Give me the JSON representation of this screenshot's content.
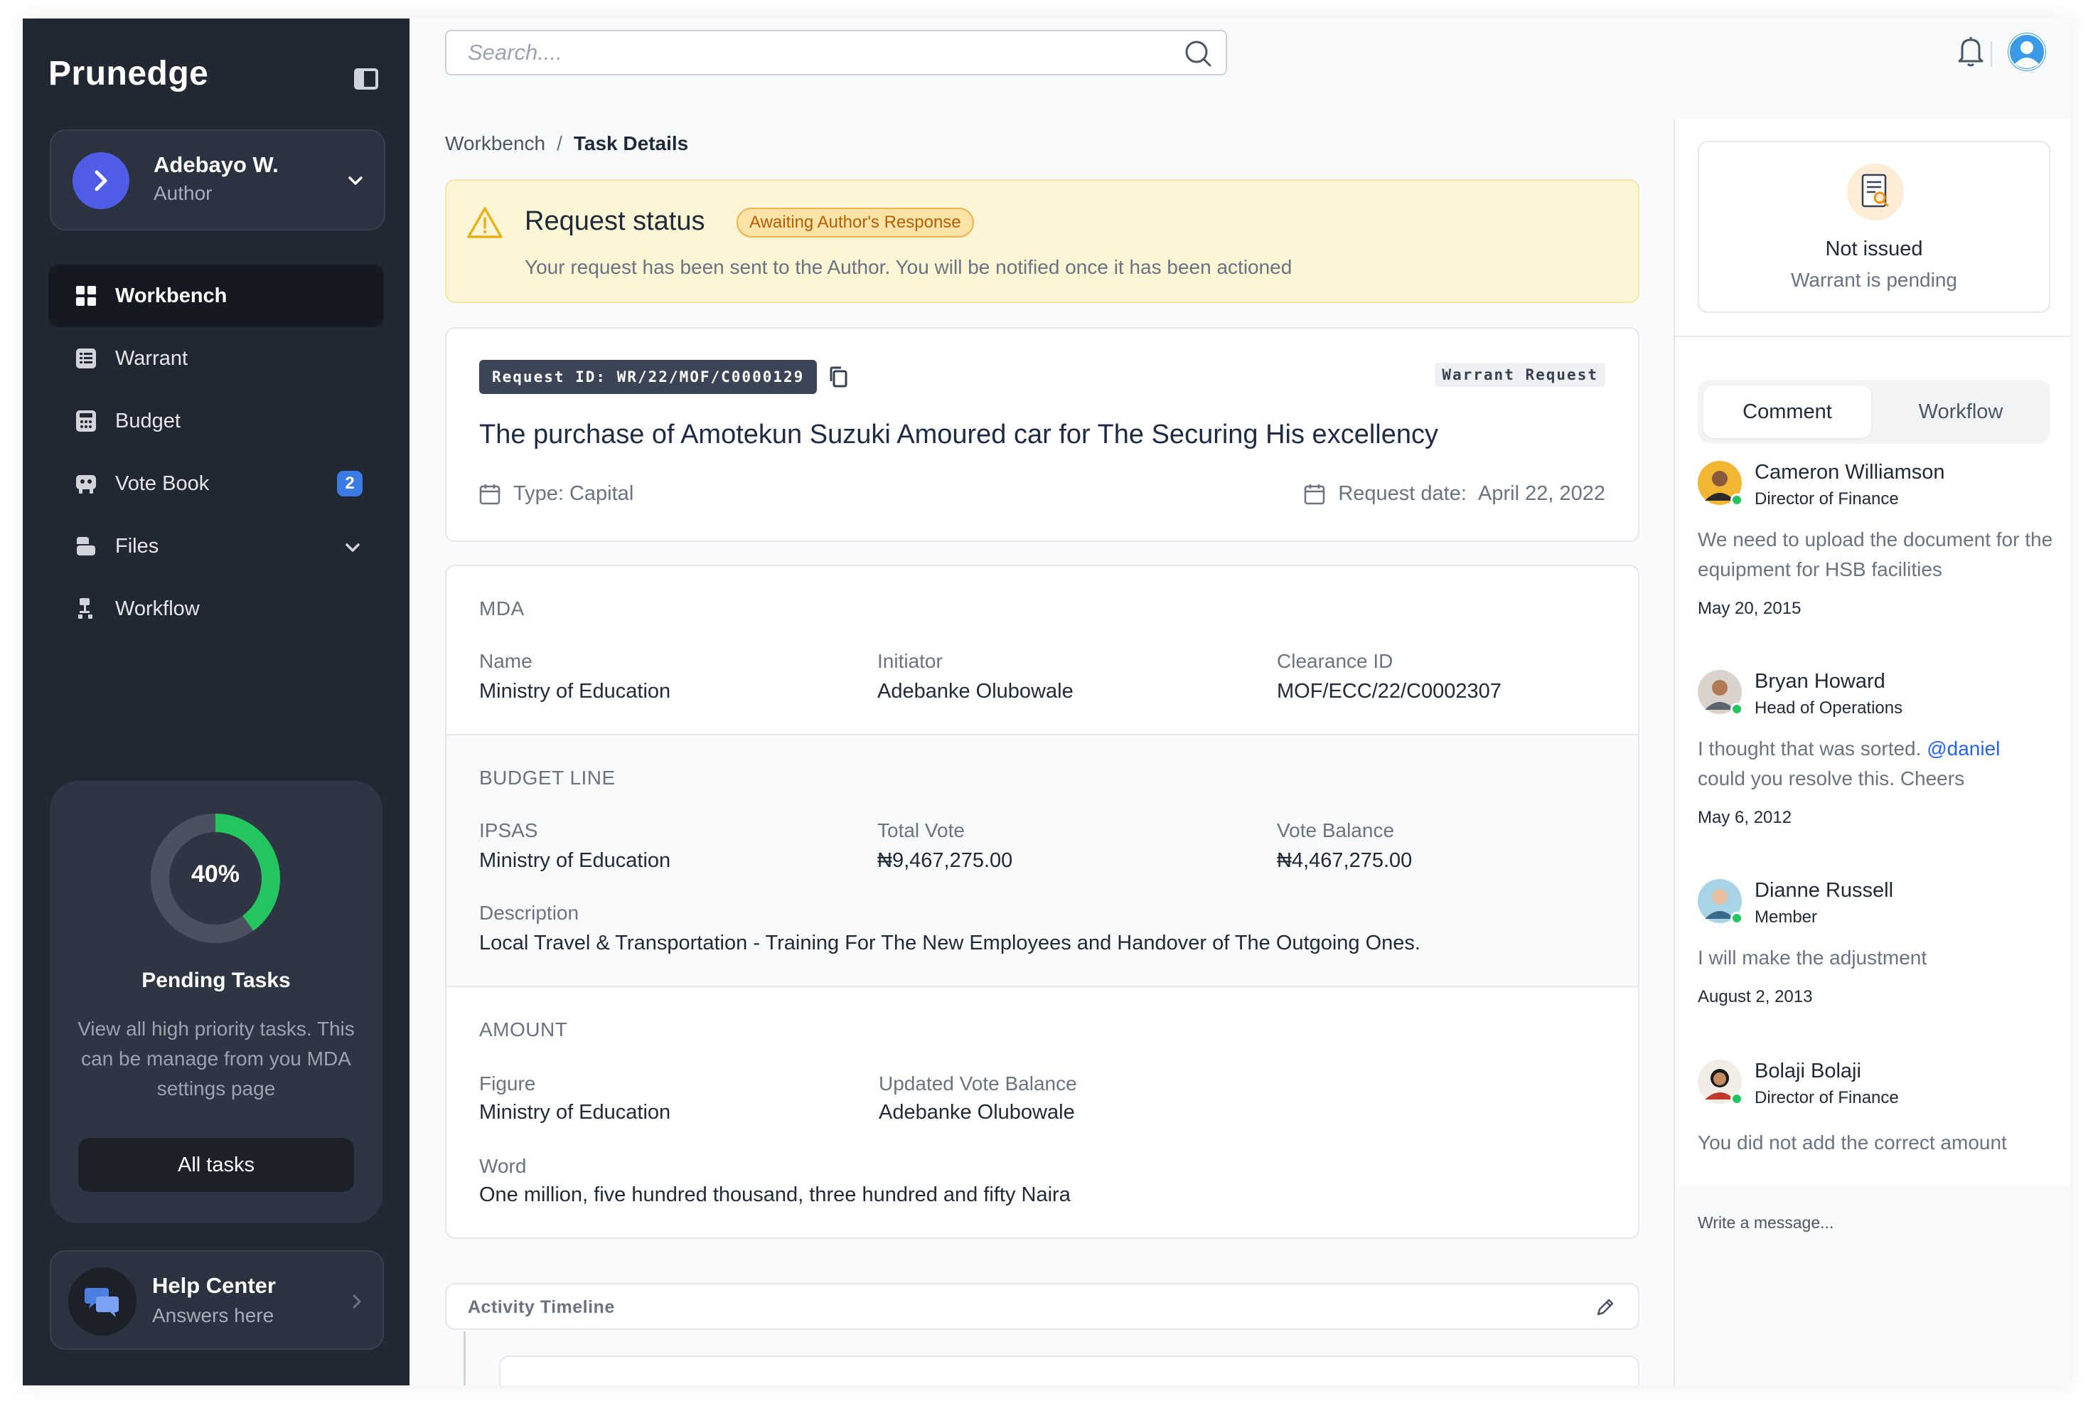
{
  "app": {
    "brand": "Prunedge"
  },
  "user": {
    "name": "Adebayo W.",
    "role": "Author"
  },
  "nav": [
    {
      "label": "Workbench",
      "icon": "grid-icon",
      "active": true
    },
    {
      "label": "Warrant",
      "icon": "list-icon"
    },
    {
      "label": "Budget",
      "icon": "calculator-icon"
    },
    {
      "label": "Vote Book",
      "icon": "vote-book-icon",
      "badge": "2"
    },
    {
      "label": "Files",
      "icon": "files-icon",
      "expandable": true
    },
    {
      "label": "Workflow",
      "icon": "workflow-icon"
    }
  ],
  "pending": {
    "percent_label": "40%",
    "percent": 40,
    "title": "Pending Tasks",
    "description": "View all high priority tasks. This can be manage from you MDA settings page",
    "button": "All tasks"
  },
  "help": {
    "title": "Help Center",
    "subtitle": "Answers here"
  },
  "header": {
    "search_placeholder": "Search...."
  },
  "breadcrumb": {
    "parent": "Workbench",
    "separator": "/",
    "current": "Task Details"
  },
  "status": {
    "title": "Request status",
    "badge": "Awaiting Author's Response",
    "description": "Your request has been sent to the  Author. You will be notified once it has been actioned"
  },
  "request": {
    "id_label": "Request  ID: WR/22/MOF/C0000129",
    "type_tag": "Warrant Request",
    "title": "The purchase of Amotekun Suzuki Amoured car for The Securing His excellency",
    "type": "Type: Capital",
    "date_label": "Request date:",
    "date": "April 22, 2022"
  },
  "mda": {
    "section": "MDA",
    "name_label": "Name",
    "name": "Ministry of Education",
    "initiator_label": "Initiator",
    "initiator": "Adebanke Olubowale",
    "clearance_label": "Clearance ID",
    "clearance": "MOF/ECC/22/C0002307"
  },
  "budget": {
    "section": "BUDGET LINE",
    "ipsas_label": "IPSAS",
    "ipsas": "Ministry of Education",
    "total_label": "Total Vote",
    "total": "₦9,467,275.00",
    "balance_label": "Vote Balance",
    "balance": "₦4,467,275.00",
    "desc_label": "Description",
    "desc": "Local Travel & Transportation - Training For The New Employees and Handover of The Outgoing Ones."
  },
  "amount": {
    "section": "AMOUNT",
    "figure_label": "Figure",
    "figure": "Ministry of Education",
    "updated_label": "Updated Vote Balance",
    "updated": "Adebanke Olubowale",
    "word_label": "Word",
    "word": "One million, five hundred thousand, three hundred and fifty Naira"
  },
  "activity": {
    "title": "Activity Timeline"
  },
  "warrant": {
    "title": "Not issued",
    "subtitle": "Warrant is pending"
  },
  "tabs": {
    "comment": "Comment",
    "workflow": "Workflow"
  },
  "comments": [
    {
      "name": "Cameron Williamson",
      "role": "Director of Finance",
      "text": "We need to upload the document for the equipment for HSB facilities",
      "date": "May 20, 2015"
    },
    {
      "name": "Bryan Howard",
      "role": "Head of Operations",
      "text_before": "I thought that was sorted. ",
      "mention": "@daniel",
      "text_after": " could you resolve this. Cheers",
      "date": "May 6, 2012"
    },
    {
      "name": "Dianne Russell",
      "role": "Member",
      "text": "I will make the adjustment",
      "date": "August 2, 2013"
    },
    {
      "name": "Bolaji Bolaji",
      "role": "Director of Finance",
      "text": "You did not add the correct amount"
    }
  ],
  "message": {
    "placeholder": "Write a message..."
  },
  "colors": {
    "sidebar": "#222833",
    "accent": "#3b7be6",
    "donut": "#22c55e",
    "warning": "#f0b24b"
  }
}
